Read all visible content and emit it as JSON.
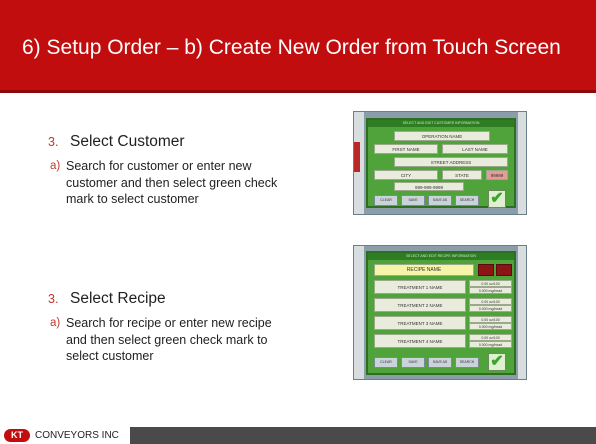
{
  "slide": {
    "title": "6) Setup Order – b) Create New Order from Touch Screen"
  },
  "steps": [
    {
      "number": "3.",
      "heading": "Select Customer",
      "sub_letter": "a)",
      "sub_text": "Search for customer or enter new customer and then select green check mark to select customer"
    },
    {
      "number": "3.",
      "heading": "Select Recipe",
      "sub_letter": "a)",
      "sub_text": "Search for recipe or enter new recipe and then select green check mark to select customer"
    }
  ],
  "customer_screen": {
    "window_title": "SELECT AND EDIT CUSTOMER INFORMATION",
    "operation_name": "OPERATION NAME",
    "first_name": "FIRST NAME",
    "last_name": "LAST NAME",
    "street_address": "STREET ADDRESS",
    "city": "CITY",
    "state": "STATE",
    "zip": "99999",
    "phone": "999-999-9999",
    "buttons": [
      "CLEAR",
      "SAVE",
      "SAVE AS",
      "SEARCH"
    ],
    "check_icon": "green-check-icon"
  },
  "recipe_screen": {
    "window_title": "SELECT AND EDIT RECIPE INFORMATION",
    "recipe_name": "RECIPE NAME",
    "treatments": [
      {
        "name": "TREATMENT 1 NAME",
        "rate1": "0.00 oz/100",
        "rate2": "0.000 mg/head"
      },
      {
        "name": "TREATMENT 2 NAME",
        "rate1": "0.00 oz/100",
        "rate2": "0.000 mg/head"
      },
      {
        "name": "TREATMENT 3 NAME",
        "rate1": "0.00 oz/100",
        "rate2": "0.000 mg/head"
      },
      {
        "name": "TREATMENT 4 NAME",
        "rate1": "0.00 oz/100",
        "rate2": "0.000 mg/head"
      }
    ],
    "buttons": [
      "CLEAR",
      "SAVE",
      "SAVE AS",
      "SEARCH"
    ],
    "check_icon": "green-check-icon"
  },
  "footer": {
    "logo_mark": "KT",
    "company": "CONVEYORS INC"
  },
  "colors": {
    "title_bar": "#c10d0d",
    "accent_number": "#c0392b",
    "screen_green": "#4fa33a",
    "footer": "#4a4a4a"
  }
}
